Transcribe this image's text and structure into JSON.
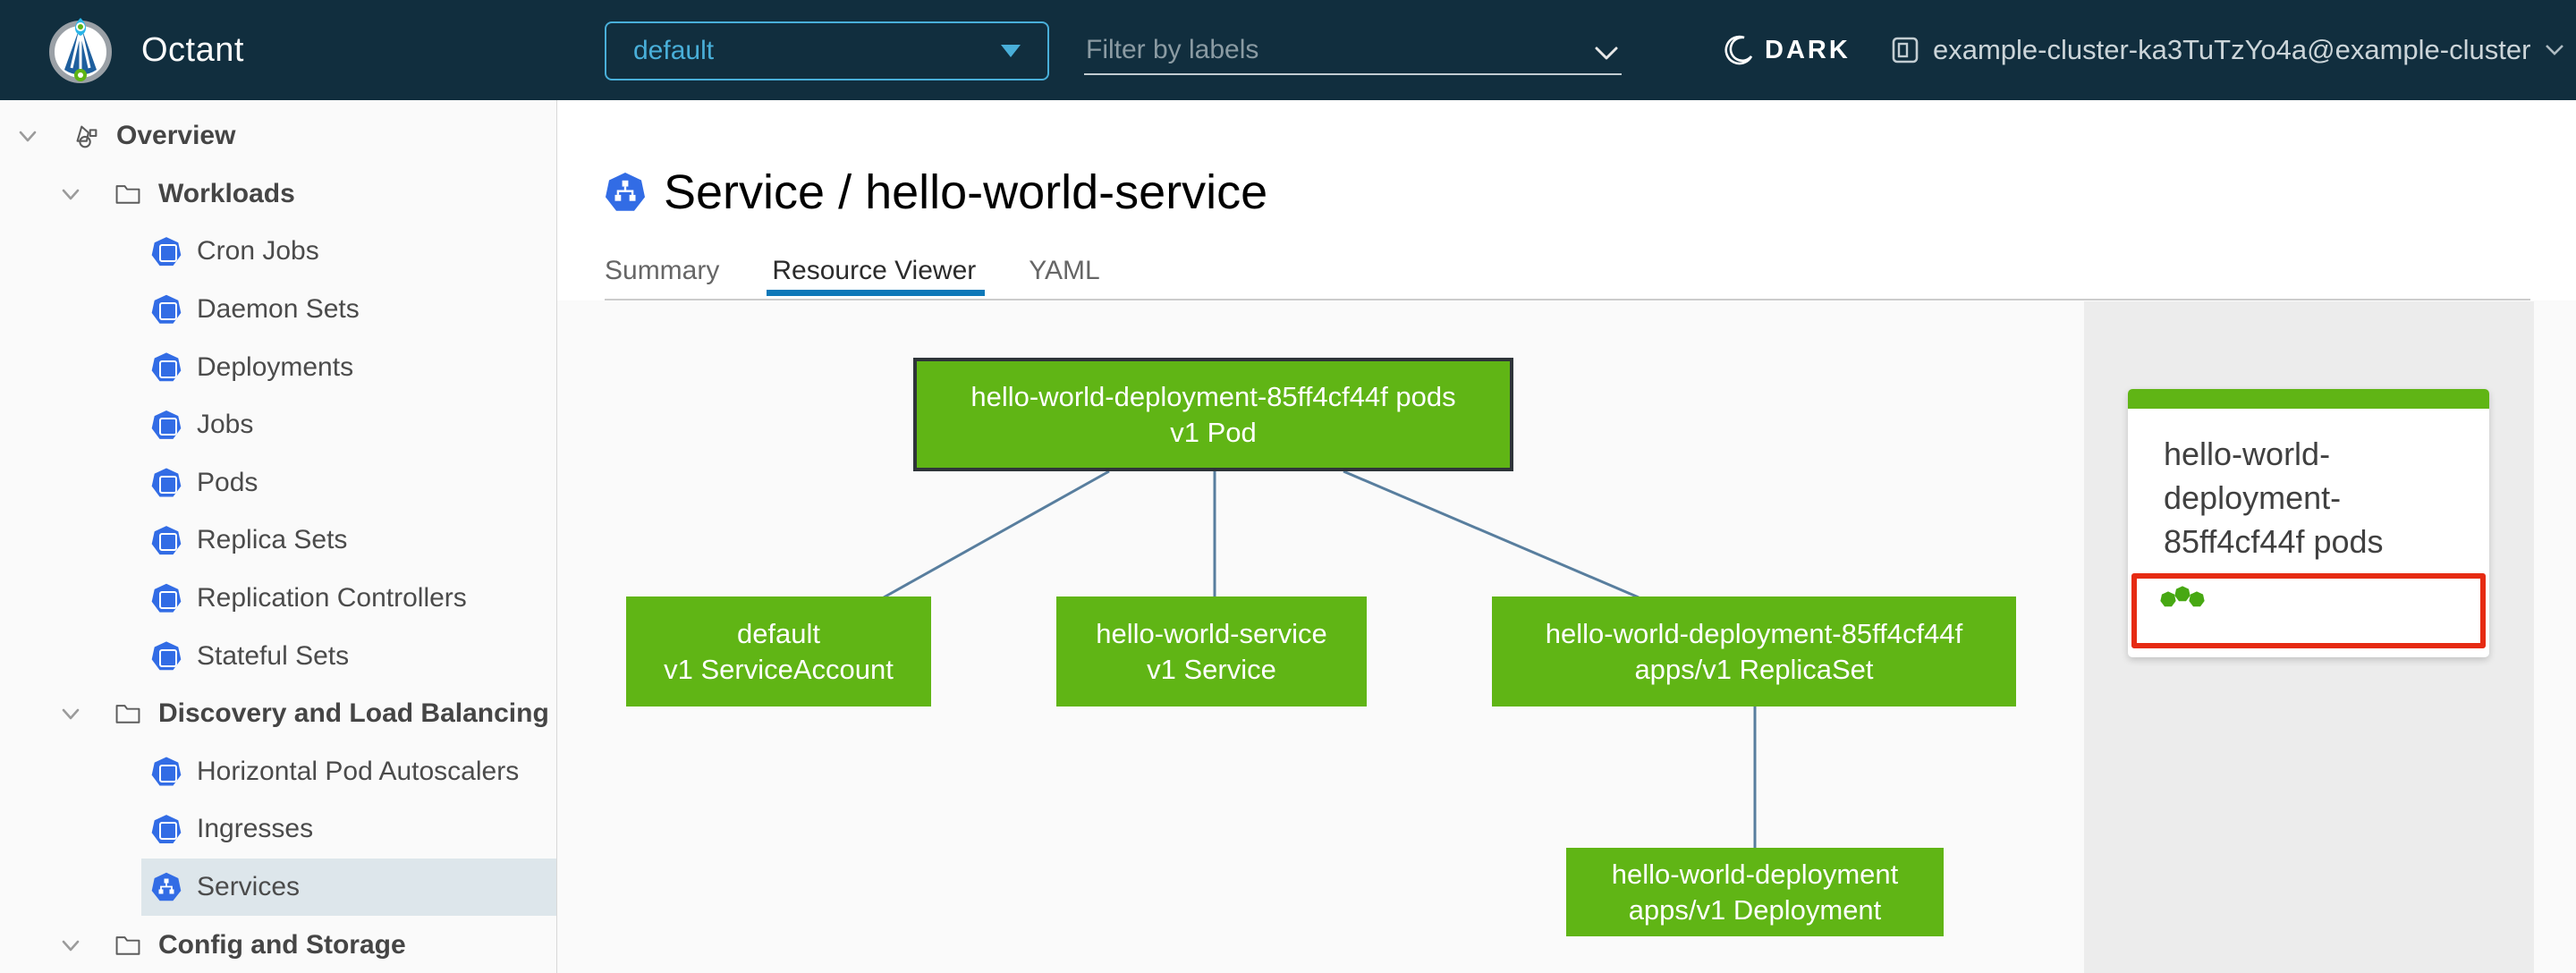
{
  "header": {
    "app_name": "Octant",
    "namespace_select": {
      "value": "default"
    },
    "filter_input": {
      "placeholder": "Filter by labels"
    },
    "theme_toggle": {
      "label": "DARK",
      "icon": "moon-icon"
    },
    "cluster_menu": {
      "label": "example-cluster-ka3TuTzYo4a@example-cluster",
      "icon": "cluster-icon"
    }
  },
  "sidebar": {
    "items": [
      {
        "label": "Overview",
        "icon": "applications-icon",
        "level": 0,
        "expanded": true
      },
      {
        "label": "Workloads",
        "icon": "folder-icon",
        "level": 1,
        "expanded": true
      },
      {
        "label": "Cron Jobs",
        "icon": "cron-jobs-icon",
        "level": 2
      },
      {
        "label": "Daemon Sets",
        "icon": "daemon-sets-icon",
        "level": 2
      },
      {
        "label": "Deployments",
        "icon": "deployments-icon",
        "level": 2
      },
      {
        "label": "Jobs",
        "icon": "jobs-icon",
        "level": 2
      },
      {
        "label": "Pods",
        "icon": "pods-icon",
        "level": 2
      },
      {
        "label": "Replica Sets",
        "icon": "replica-sets-icon",
        "level": 2
      },
      {
        "label": "Replication Controllers",
        "icon": "replication-controllers-icon",
        "level": 2
      },
      {
        "label": "Stateful Sets",
        "icon": "stateful-sets-icon",
        "level": 2
      },
      {
        "label": "Discovery and Load Balancing",
        "icon": "folder-icon",
        "level": 1,
        "expanded": true
      },
      {
        "label": "Horizontal Pod Autoscalers",
        "icon": "horizontal-pod-autoscalers-icon",
        "level": 2
      },
      {
        "label": "Ingresses",
        "icon": "ingresses-icon",
        "level": 2
      },
      {
        "label": "Services",
        "icon": "services-icon",
        "level": 2,
        "selected": true
      },
      {
        "label": "Config and Storage",
        "icon": "folder-icon",
        "level": 1,
        "expanded": true
      }
    ]
  },
  "main": {
    "page": {
      "title": "Service / hello-world-service",
      "icon": "service-resource-icon"
    },
    "tabs": [
      {
        "label": "Summary",
        "active": false
      },
      {
        "label": "Resource Viewer",
        "active": true
      },
      {
        "label": "YAML",
        "active": false
      }
    ]
  },
  "graph": {
    "nodes": [
      {
        "id": "pod",
        "title": "hello-world-deployment-85ff4cf44f pods",
        "subtitle": "v1 Pod",
        "status": "ok",
        "selected": true
      },
      {
        "id": "serviceaccount",
        "title": "default",
        "subtitle": "v1 ServiceAccount",
        "status": "ok"
      },
      {
        "id": "service",
        "title": "hello-world-service",
        "subtitle": "v1 Service",
        "status": "ok"
      },
      {
        "id": "replicaset",
        "title": "hello-world-deployment-85ff4cf44f",
        "subtitle": "apps/v1 ReplicaSet",
        "status": "ok"
      },
      {
        "id": "deployment",
        "title": "hello-world-deployment",
        "subtitle": "apps/v1 Deployment",
        "status": "ok"
      }
    ],
    "edges": [
      [
        "pod",
        "serviceaccount"
      ],
      [
        "pod",
        "service"
      ],
      [
        "pod",
        "replicaset"
      ],
      [
        "replicaset",
        "deployment"
      ]
    ]
  },
  "side_panel": {
    "card": {
      "title": "hello-world-deployment-85ff4cf44f pods",
      "pod_status_dots": 3
    }
  },
  "colors": {
    "header_bg": "#112e3e",
    "accent_blue": "#49afd9",
    "active_tab_blue": "#0e78b8",
    "node_green": "#60b515",
    "k8s_icon_blue": "#326ce5",
    "edge_blue": "#587e9e",
    "highlight_red": "#e62b13",
    "selected_row_bg": "#dde6eb"
  }
}
